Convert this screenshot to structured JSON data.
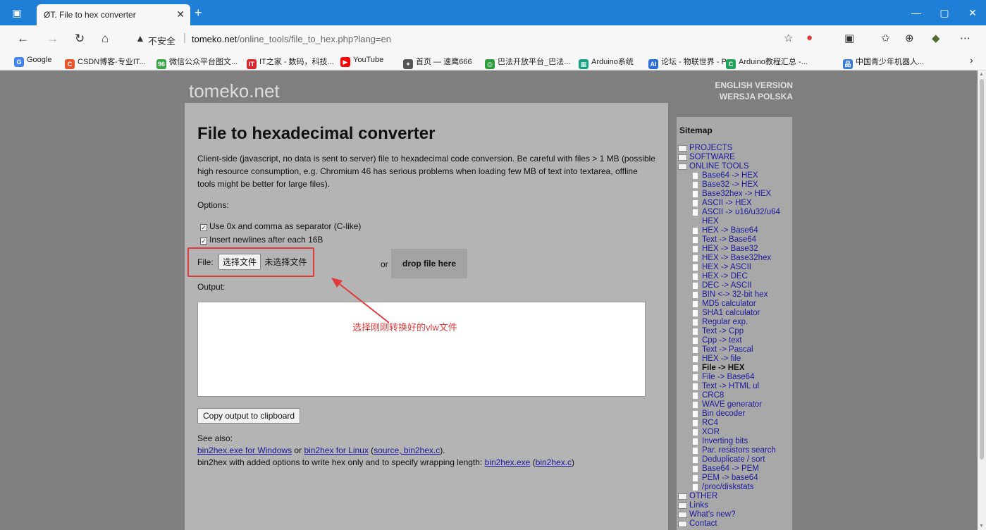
{
  "browser": {
    "tab_title": "ØT. File to hex converter",
    "tab_close": "✕",
    "new_tab": "+",
    "insecure_label": "不安全",
    "url_host": "tomeko.net",
    "url_path": "/online_tools/file_to_hex.php?lang=en",
    "window_controls": [
      "—",
      "▢",
      "✕"
    ]
  },
  "bookmarks": [
    {
      "label": "Google",
      "icon": "G",
      "color": "#4285f4"
    },
    {
      "label": "CSDN博客-专业IT...",
      "icon": "C",
      "color": "#e8552d"
    },
    {
      "label": "微信公众平台图文...",
      "icon": "96",
      "color": "#3aa546"
    },
    {
      "label": "IT之家 - 数码，科技...",
      "icon": "IT",
      "color": "#d7262e"
    },
    {
      "label": "YouTube",
      "icon": "▶",
      "color": "#ff0000"
    },
    {
      "label": "首页 — 速鹰666",
      "icon": "✦",
      "color": "#555555"
    },
    {
      "label": "巴法开放平台_巴法...",
      "icon": "◎",
      "color": "#2e9b3a"
    },
    {
      "label": "Arduino系统",
      "icon": "▦",
      "color": "#14a085"
    },
    {
      "label": "论坛 - 物联世界 - P...",
      "icon": "AI",
      "color": "#2a6bd6"
    },
    {
      "label": "Arduino教程汇总 -...",
      "icon": "C",
      "color": "#21a35a"
    },
    {
      "label": "中国青少年机器人...",
      "icon": "品",
      "color": "#3b7bd8"
    }
  ],
  "site": {
    "logo": "tomeko.net",
    "lang_en": "ENGLISH VERSION",
    "lang_pl": "WERSJA POLSKA"
  },
  "main": {
    "title": "File to hexadecimal converter",
    "description": "Client-side (javascript, no data is sent to server) file to hexadecimal code conversion. Be careful with files > 1 MB (possible high resource consumption, e.g. Chromium 46 has serious problems when loading few MB of text into textarea, offline tools might be better for large files).",
    "options_label": "Options:",
    "option1": "Use 0x and comma as separator (C-like)",
    "option2": "Insert newlines after each 16B",
    "file_label": "File:",
    "file_button": "选择文件",
    "file_none": "未选择文件",
    "or": "or",
    "drop_label": "drop file here",
    "output_label": "Output:",
    "copy_button": "Copy output to clipboard",
    "see_also": "See also:",
    "link_win": "bin2hex.exe for Windows",
    "word_or": "or",
    "link_linux": "bin2hex for Linux",
    "link_source": "source, bin2hex.c",
    "line3_text": "bin2hex with added options to write hex only and to specify wrapping length:",
    "link_exe": "bin2hex.exe",
    "link_c": "bin2hex.c"
  },
  "annotation": {
    "text": "选择刚刚转换好的vlw文件",
    "color": "#e23a3a"
  },
  "sitemap": {
    "title": "Sitemap",
    "items": [
      {
        "label": "PROJECTS",
        "level": "top"
      },
      {
        "label": "SOFTWARE",
        "level": "top"
      },
      {
        "label": "ONLINE TOOLS",
        "level": "top"
      },
      {
        "label": "Base64 -> HEX",
        "level": "sub"
      },
      {
        "label": "Base32 -> HEX",
        "level": "sub"
      },
      {
        "label": "Base32hex -> HEX",
        "level": "sub"
      },
      {
        "label": "ASCII -> HEX",
        "level": "sub"
      },
      {
        "label": "ASCII -> u16/u32/u64",
        "level": "sub"
      },
      {
        "label": "HEX",
        "level": "cont"
      },
      {
        "label": "HEX -> Base64",
        "level": "sub"
      },
      {
        "label": "Text -> Base64",
        "level": "sub"
      },
      {
        "label": "HEX -> Base32",
        "level": "sub"
      },
      {
        "label": "HEX -> Base32hex",
        "level": "sub"
      },
      {
        "label": "HEX -> ASCII",
        "level": "sub"
      },
      {
        "label": "HEX -> DEC",
        "level": "sub"
      },
      {
        "label": "DEC -> ASCII",
        "level": "sub"
      },
      {
        "label": "BIN <-> 32-bit hex",
        "level": "sub"
      },
      {
        "label": "MD5 calculator",
        "level": "sub"
      },
      {
        "label": "SHA1 calculator",
        "level": "sub"
      },
      {
        "label": "Regular exp.",
        "level": "sub"
      },
      {
        "label": "Text -> Cpp",
        "level": "sub"
      },
      {
        "label": "Cpp -> text",
        "level": "sub"
      },
      {
        "label": "Text -> Pascal",
        "level": "sub"
      },
      {
        "label": "HEX -> file",
        "level": "sub"
      },
      {
        "label": "File -> HEX",
        "level": "sub",
        "current": true
      },
      {
        "label": "File -> Base64",
        "level": "sub"
      },
      {
        "label": "Text -> HTML ul",
        "level": "sub"
      },
      {
        "label": "CRC8",
        "level": "sub"
      },
      {
        "label": "WAVE generator",
        "level": "sub"
      },
      {
        "label": "Bin decoder",
        "level": "sub"
      },
      {
        "label": "RC4",
        "level": "sub"
      },
      {
        "label": "XOR",
        "level": "sub"
      },
      {
        "label": "Inverting bits",
        "level": "sub"
      },
      {
        "label": "Par. resistors search",
        "level": "sub"
      },
      {
        "label": "Deduplicate / sort",
        "level": "sub"
      },
      {
        "label": "Base64 -> PEM",
        "level": "sub"
      },
      {
        "label": "PEM -> base64",
        "level": "sub"
      },
      {
        "label": "/proc/diskstats",
        "level": "sub"
      },
      {
        "label": "OTHER",
        "level": "top"
      },
      {
        "label": "Links",
        "level": "top"
      },
      {
        "label": "What's new?",
        "level": "top"
      },
      {
        "label": "Contact",
        "level": "top"
      }
    ]
  }
}
